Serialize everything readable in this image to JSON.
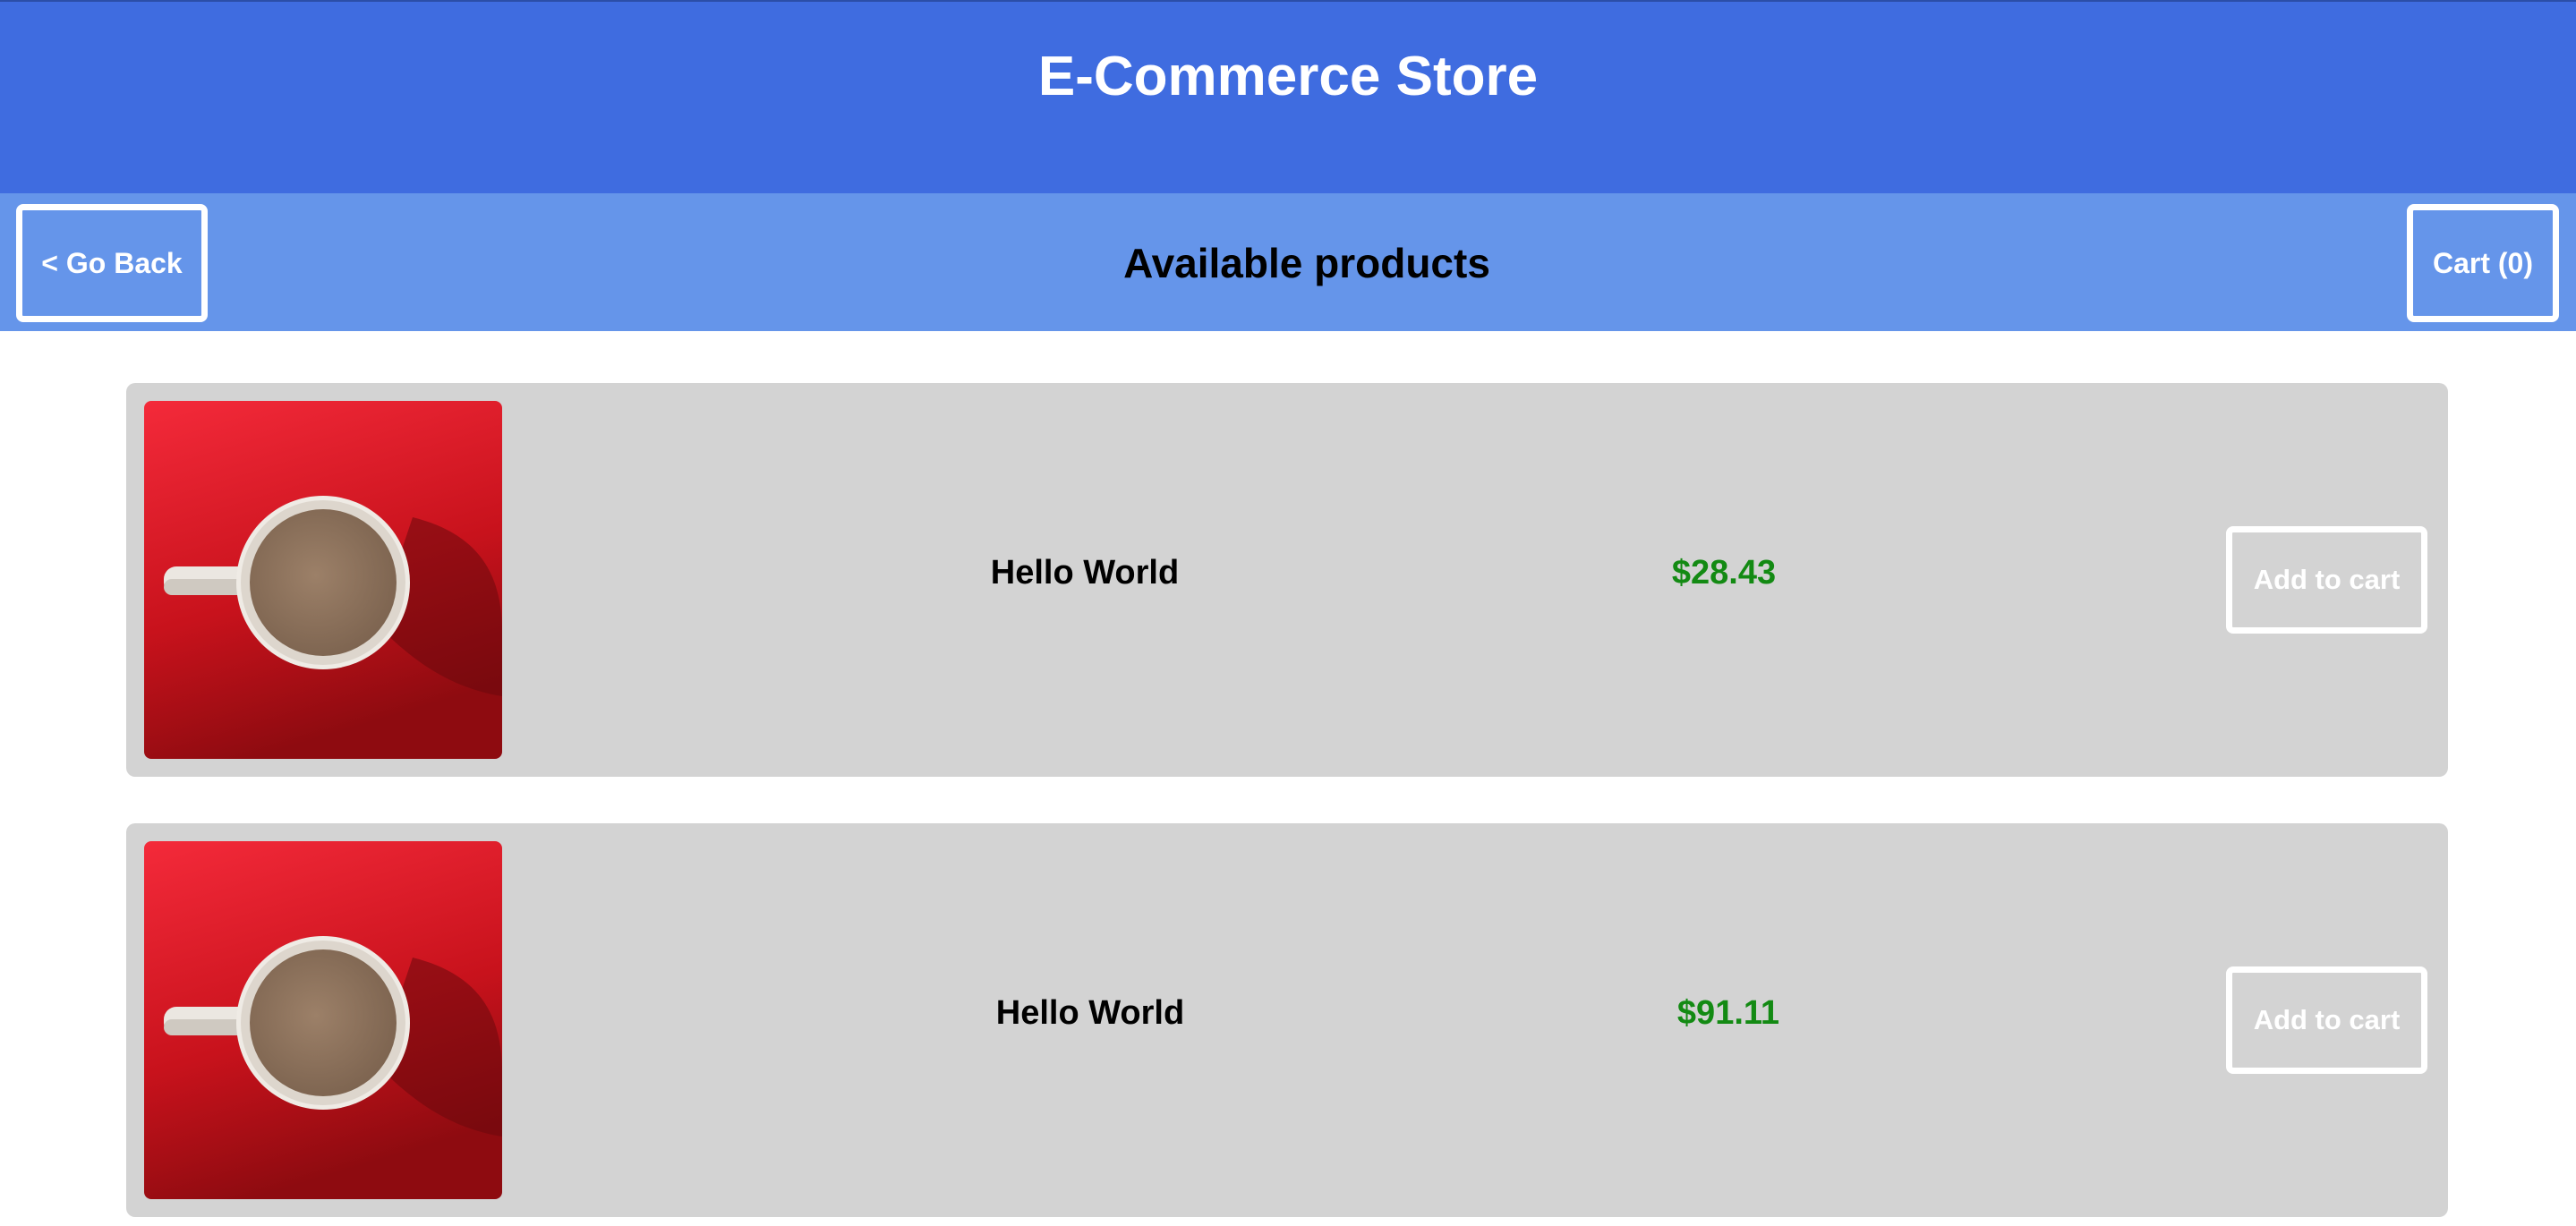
{
  "header": {
    "title": "E-Commerce Store"
  },
  "subnav": {
    "back_label": "< Go Back",
    "title": "Available products",
    "cart_label": "Cart (0)"
  },
  "products": [
    {
      "name": "Hello World",
      "price": "$28.43",
      "button_label": "Add to cart",
      "image": "coffee-cup-on-red-background"
    },
    {
      "name": "Hello World",
      "price": "$91.11",
      "button_label": "Add to cart",
      "image": "coffee-cup-on-red-background"
    }
  ],
  "colors": {
    "header_bg": "#3f6ce0",
    "subnav_bg": "#6595ea",
    "card_bg": "#d3d3d3",
    "price": "#138a13"
  }
}
